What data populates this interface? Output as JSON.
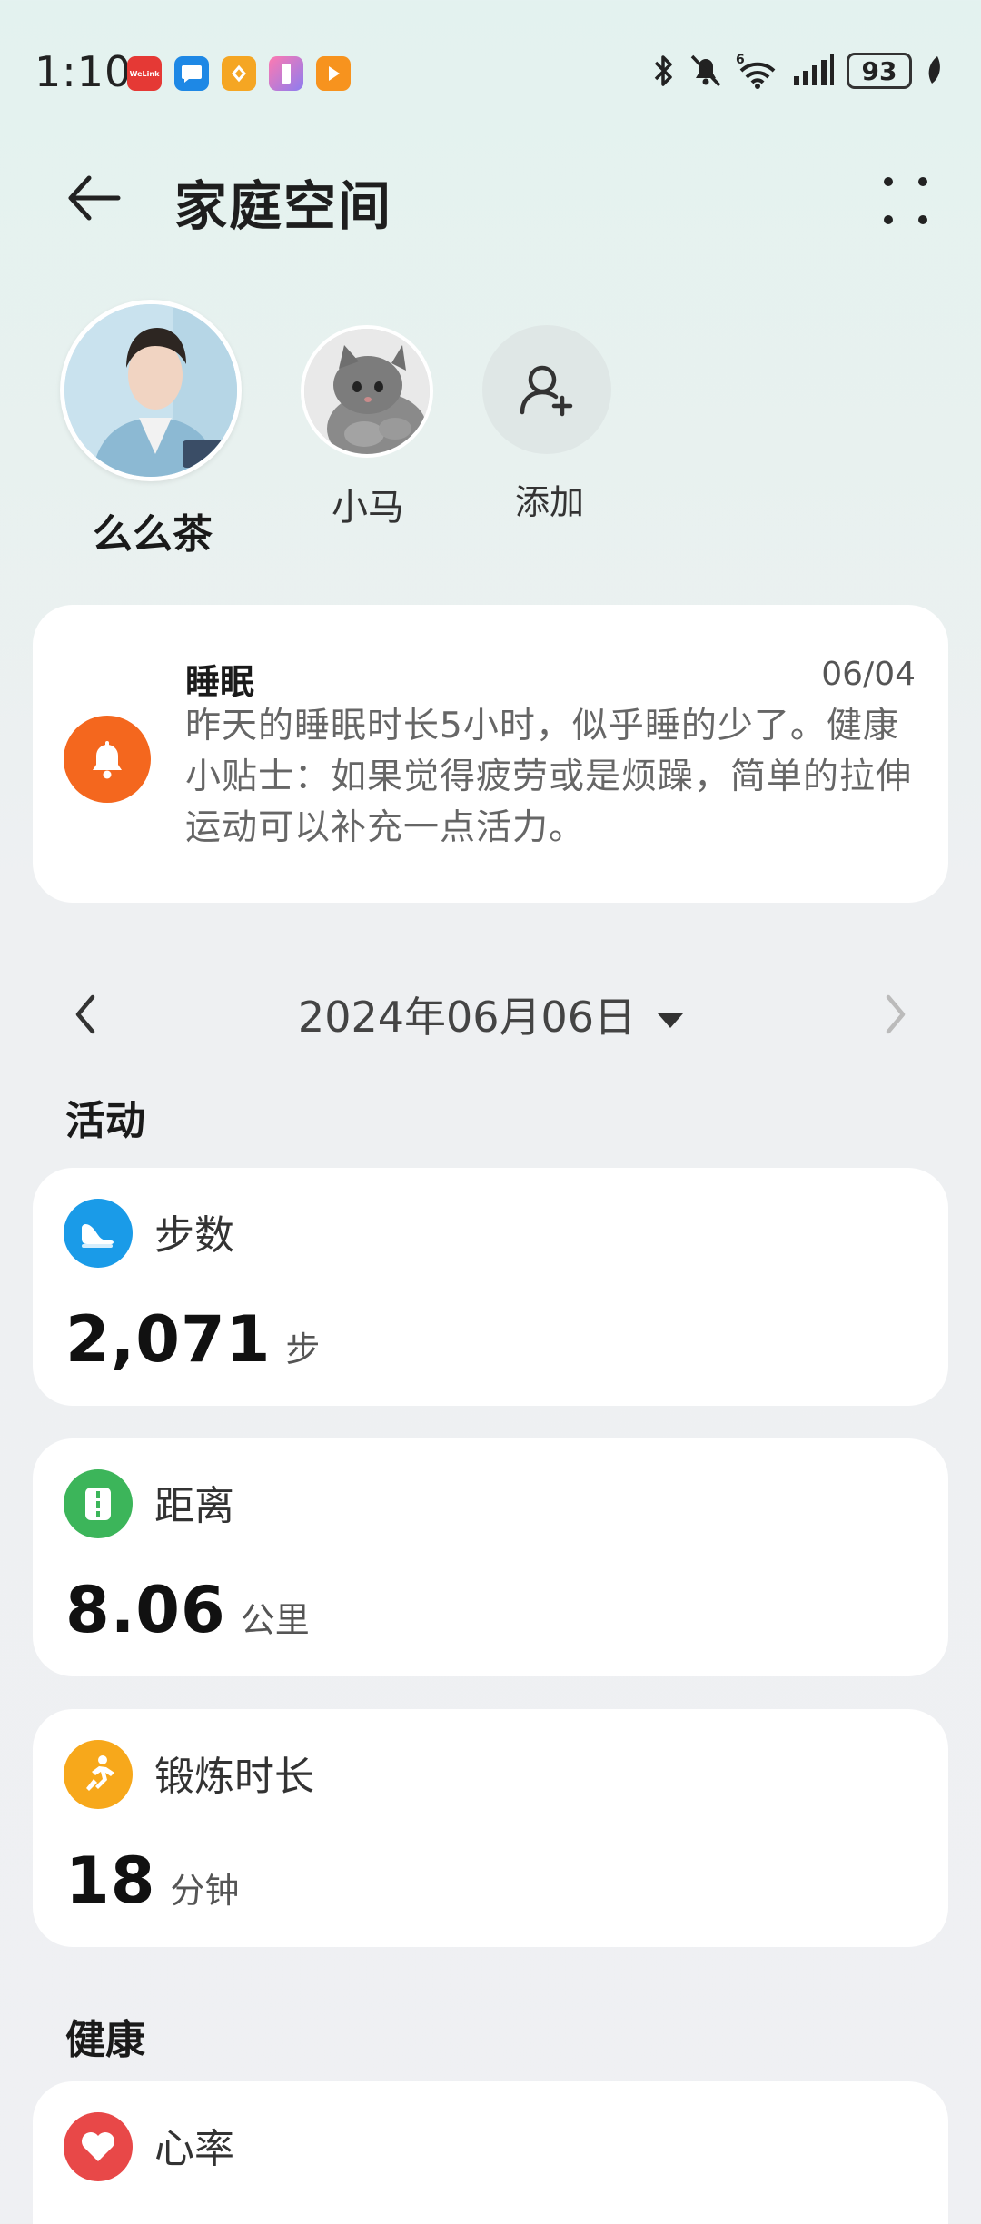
{
  "status_bar": {
    "time": "1:10",
    "notification_apps": [
      {
        "name": "welink-icon",
        "label": "WeLink",
        "color": "#e53935"
      },
      {
        "name": "message-icon",
        "label": "",
        "color": "#1e88e5"
      },
      {
        "name": "app-orange-icon",
        "label": "",
        "color": "#f5a623"
      },
      {
        "name": "app-gradient-icon",
        "label": "",
        "color": "#e94f9a"
      },
      {
        "name": "app-play-icon",
        "label": "",
        "color": "#f7931e"
      }
    ],
    "battery": "93"
  },
  "header": {
    "title": "家庭空间"
  },
  "members": [
    {
      "name": "么么茶",
      "active": true
    },
    {
      "name": "小马",
      "active": false
    }
  ],
  "add_member_label": "添加",
  "alert": {
    "title": "睡眠",
    "date": "06/04",
    "text": "昨天的睡眠时长5小时，似乎睡的少了。健康小贴士：如果觉得疲劳或是烦躁，简单的拉伸运动可以补充一点活力。"
  },
  "date_nav": {
    "date": "2024年06月06日"
  },
  "sections": {
    "activity": "活动",
    "health": "健康"
  },
  "metrics": {
    "steps": {
      "label": "步数",
      "value": "2,071",
      "unit": "步",
      "color": "#1a9be8"
    },
    "distance": {
      "label": "距离",
      "value": "8.06",
      "unit": "公里",
      "color": "#3cb55a"
    },
    "exercise": {
      "label": "锻炼时长",
      "value": "18",
      "unit": "分钟",
      "color": "#f7a81b"
    },
    "heart_rate": {
      "label": "心率",
      "color": "#e84848"
    }
  }
}
